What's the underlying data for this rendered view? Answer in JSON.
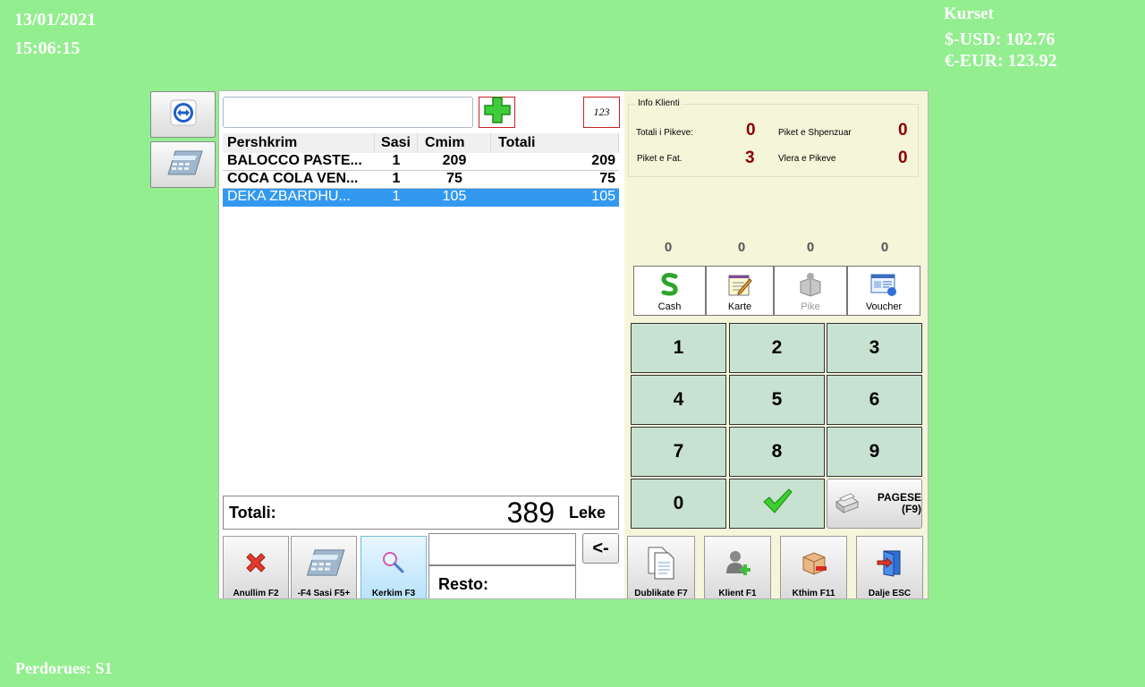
{
  "header": {
    "date": "13/01/2021",
    "time": "15:06:15"
  },
  "rates": {
    "title": "Kurset",
    "usd": "$-USD: 102.76",
    "eur": "€-EUR: 123.92"
  },
  "footer": {
    "user": "Perdorues: S1"
  },
  "side_buttons": {
    "teamviewer_icon": "teamviewer-icon",
    "calculator_icon": "calculator-icon"
  },
  "search": {
    "value": "",
    "placeholder": ""
  },
  "toolbar": {
    "add_icon": "plus-icon",
    "numeric_label": "123"
  },
  "table": {
    "headers": [
      "Pershkrim",
      "Sasi",
      "Cmim",
      "Totali"
    ],
    "rows": [
      {
        "desc": "BALOCCO PASTE...",
        "qty": "1",
        "price": "209",
        "total": "209"
      },
      {
        "desc": "COCA COLA VEN...",
        "qty": "1",
        "price": "75",
        "total": "75"
      },
      {
        "desc": "DEKA ZBARDHU...",
        "qty": "1",
        "price": "105",
        "total": "105"
      }
    ],
    "selected_row": 2
  },
  "totals": {
    "label": "Totali:",
    "value": "389",
    "currency": "Leke"
  },
  "bottom_buttons": {
    "anullim": "Anullim F2",
    "sasi": "-F4 Sasi F5+",
    "kerkim": "Kerkim F3"
  },
  "resto": {
    "label": "Resto:",
    "back_label": "<-"
  },
  "client_info": {
    "legend": "Info Klienti",
    "total_points_label": "Totali i Pikeve:",
    "total_points": "0",
    "spent_points_label": "Piket e Shpenzuar",
    "spent_points": "0",
    "invoice_points_label": "Piket e Fat.",
    "invoice_points": "3",
    "points_value_label": "Vlera e Pikeve",
    "points_value": "0"
  },
  "payment_counts": [
    "0",
    "0",
    "0",
    "0"
  ],
  "payment_methods": {
    "cash": "Cash",
    "karte": "Karte",
    "pike": "Pike",
    "voucher": "Voucher"
  },
  "keypad": {
    "k1": "1",
    "k2": "2",
    "k3": "3",
    "k4": "4",
    "k5": "5",
    "k6": "6",
    "k7": "7",
    "k8": "8",
    "k9": "9",
    "k0": "0",
    "pagese_line1": "PAGESE",
    "pagese_line2": "(F9)"
  },
  "actions": {
    "dublikate": "Dublikate F7",
    "klient": "Klient F1",
    "kthim": "Kthim F11",
    "dalje": "Dalje ESC"
  },
  "colors": {
    "background": "#93ee8f",
    "selected_row": "#3399f0",
    "keypad": "#c8e2d2",
    "points_value": "#8b0000",
    "panel": "#f5f5da"
  }
}
